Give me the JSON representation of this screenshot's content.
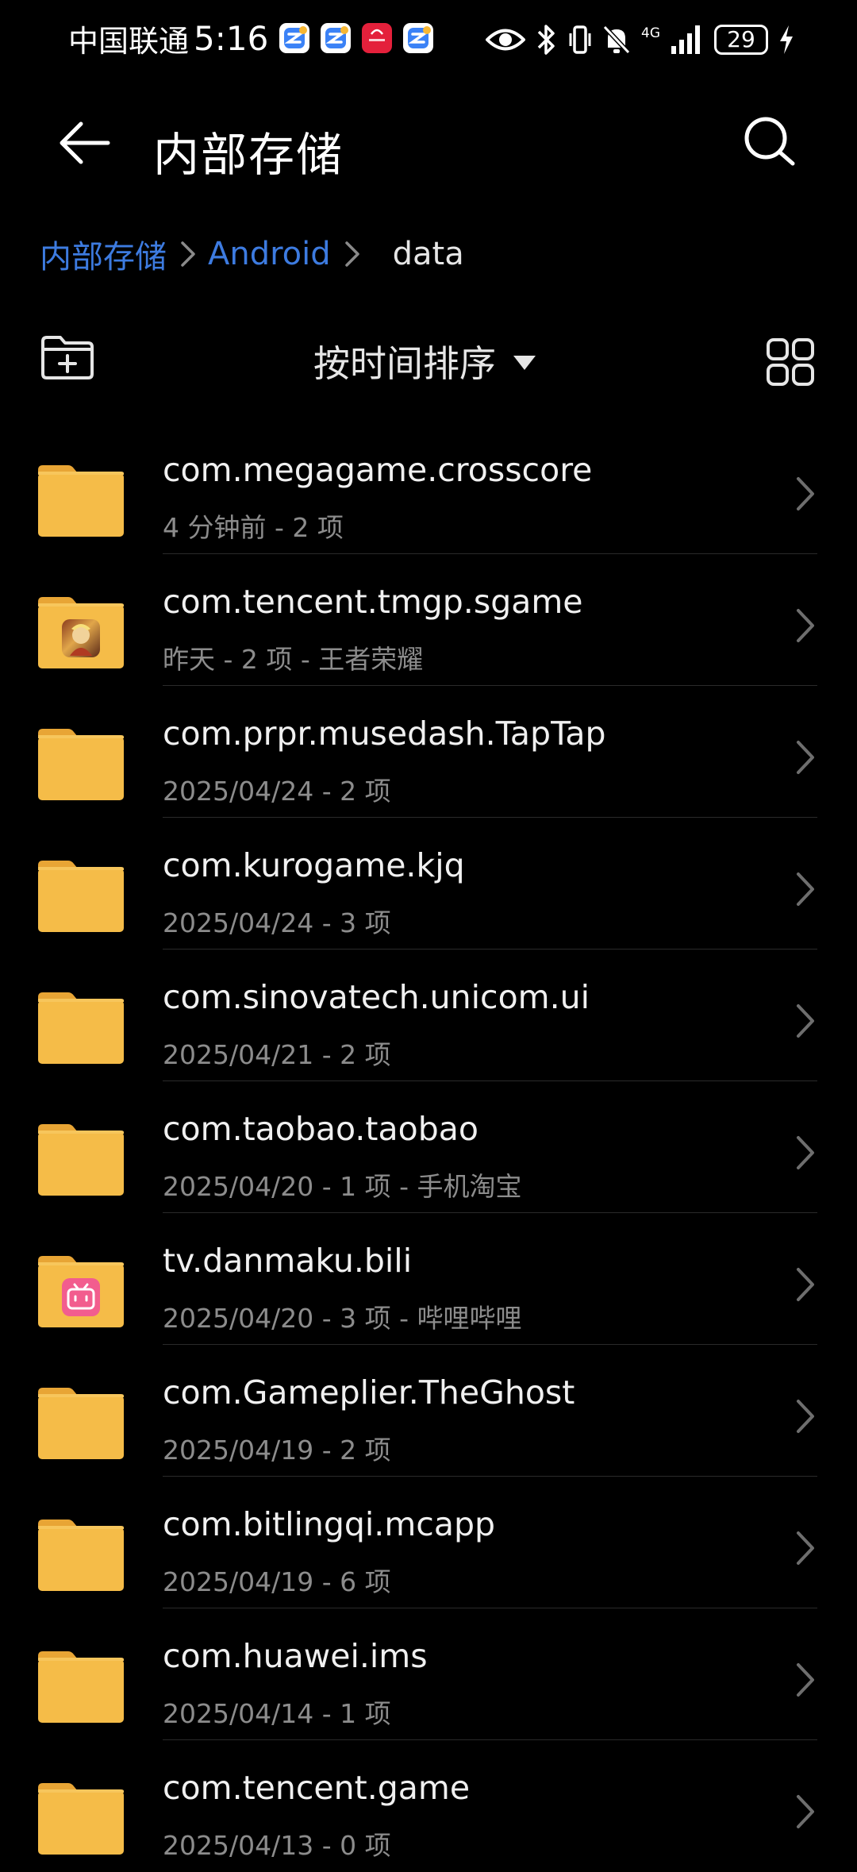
{
  "status_bar": {
    "carrier": "中国联通",
    "time": "5:16",
    "network_label": "4G",
    "battery": "29"
  },
  "app_bar": {
    "title": "内部存储"
  },
  "breadcrumb": {
    "items": [
      "内部存储",
      "Android"
    ],
    "current": "data"
  },
  "toolbar": {
    "sort_label": "按时间排序"
  },
  "colors": {
    "background": "#000000",
    "folder": "#f5bc48",
    "folder_tab": "#e8a535",
    "link": "#3d7be0",
    "meta_text": "#8c8c8c"
  },
  "files": [
    {
      "name": "com.megagame.crosscore",
      "meta": "4 分钟前 - 2 项",
      "badge": ""
    },
    {
      "name": "com.tencent.tmgp.sgame",
      "meta": "昨天 - 2 项 - 王者荣耀",
      "badge": "game"
    },
    {
      "name": "com.prpr.musedash.TapTap",
      "meta": "2025/04/24 - 2 项",
      "badge": ""
    },
    {
      "name": "com.kurogame.kjq",
      "meta": "2025/04/24 - 3 项",
      "badge": ""
    },
    {
      "name": "com.sinovatech.unicom.ui",
      "meta": "2025/04/21 - 2 项",
      "badge": ""
    },
    {
      "name": "com.taobao.taobao",
      "meta": "2025/04/20 - 1 项 - 手机淘宝",
      "badge": ""
    },
    {
      "name": "tv.danmaku.bili",
      "meta": "2025/04/20 - 3 项 - 哔哩哔哩",
      "badge": "bili"
    },
    {
      "name": "com.Gameplier.TheGhost",
      "meta": "2025/04/19 - 2 项",
      "badge": ""
    },
    {
      "name": "com.bitlingqi.mcapp",
      "meta": "2025/04/19 - 6 项",
      "badge": ""
    },
    {
      "name": "com.huawei.ims",
      "meta": "2025/04/14 - 1 项",
      "badge": ""
    },
    {
      "name": "com.tencent.game",
      "meta": "2025/04/13 - 0 项",
      "badge": ""
    }
  ]
}
